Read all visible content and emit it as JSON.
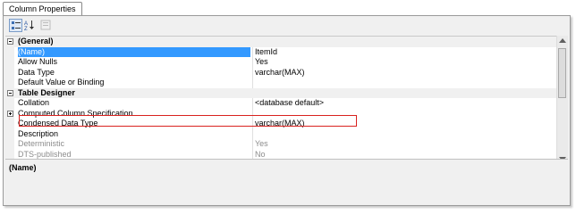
{
  "tab": {
    "label": "Column Properties"
  },
  "grid": {
    "rows": [
      {
        "kind": "cat",
        "expander": "minus",
        "name": "(General)",
        "value": ""
      },
      {
        "kind": "prop",
        "name": "(Name)",
        "value": "ItemId",
        "selected": true
      },
      {
        "kind": "prop",
        "name": "Allow Nulls",
        "value": "Yes"
      },
      {
        "kind": "prop",
        "name": "Data Type",
        "value": "varchar(MAX)"
      },
      {
        "kind": "prop",
        "name": "Default Value or Binding",
        "value": ""
      },
      {
        "kind": "cat",
        "expander": "minus",
        "name": "Table Designer",
        "value": ""
      },
      {
        "kind": "prop",
        "name": "Collation",
        "value": "<database default>"
      },
      {
        "kind": "prop",
        "expander": "plus",
        "name": "Computed Column Specification",
        "value": ""
      },
      {
        "kind": "prop",
        "name": "Condensed Data Type",
        "value": "varchar(MAX)"
      },
      {
        "kind": "prop",
        "name": "Description",
        "value": ""
      },
      {
        "kind": "prop",
        "name": "Deterministic",
        "value": "Yes",
        "dim": true
      },
      {
        "kind": "prop",
        "name": "DTS-published",
        "value": "No",
        "dim": true
      }
    ]
  },
  "description": {
    "title": "(Name)"
  },
  "colors": {
    "selection": "#3399ff",
    "highlight_box": "#d9221f"
  },
  "icons": {
    "categorized": "categorized-icon",
    "alphabetical": "sort-az-icon",
    "property_pages": "property-pages-icon"
  }
}
